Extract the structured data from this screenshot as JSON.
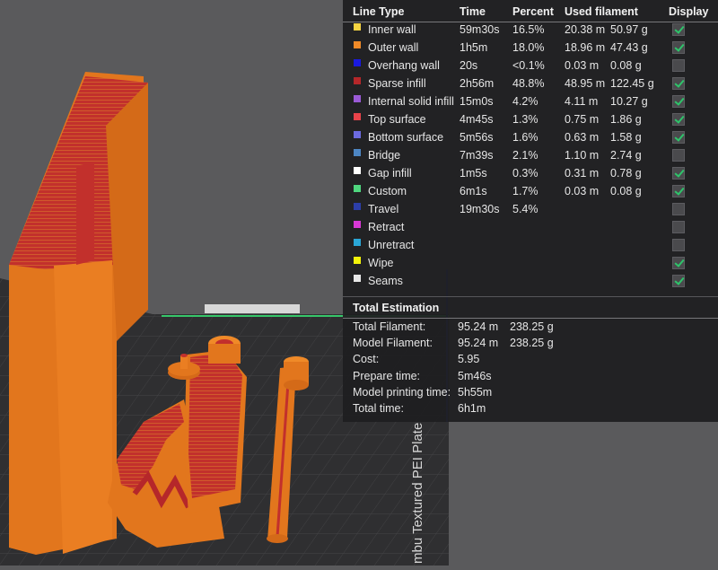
{
  "panel": {
    "headers": {
      "line_type": "Line Type",
      "time": "Time",
      "percent": "Percent",
      "used_filament": "Used filament",
      "display": "Display"
    },
    "rows": [
      {
        "label": "Inner wall",
        "color": "#f5d442",
        "time": "59m30s",
        "percent": "16.5%",
        "length": "20.38 m",
        "weight": "50.97 g",
        "display": true
      },
      {
        "label": "Outer wall",
        "color": "#f08a28",
        "time": "1h5m",
        "percent": "18.0%",
        "length": "18.96 m",
        "weight": "47.43 g",
        "display": true
      },
      {
        "label": "Overhang wall",
        "color": "#1a1adf",
        "time": "20s",
        "percent": "<0.1%",
        "length": "0.03 m",
        "weight": "0.08 g",
        "display": false
      },
      {
        "label": "Sparse infill",
        "color": "#b5272a",
        "time": "2h56m",
        "percent": "48.8%",
        "length": "48.95 m",
        "weight": "122.45 g",
        "display": true
      },
      {
        "label": "Internal solid infill",
        "color": "#9a5ad6",
        "time": "15m0s",
        "percent": "4.2%",
        "length": "4.11 m",
        "weight": "10.27 g",
        "display": true
      },
      {
        "label": "Top surface",
        "color": "#e8434a",
        "time": "4m45s",
        "percent": "1.3%",
        "length": "0.75 m",
        "weight": "1.86 g",
        "display": true
      },
      {
        "label": "Bottom surface",
        "color": "#6c6ae0",
        "time": "5m56s",
        "percent": "1.6%",
        "length": "0.63 m",
        "weight": "1.58 g",
        "display": true
      },
      {
        "label": "Bridge",
        "color": "#4d86c4",
        "time": "7m39s",
        "percent": "2.1%",
        "length": "1.10 m",
        "weight": "2.74 g",
        "display": false
      },
      {
        "label": "Gap infill",
        "color": "#ffffff",
        "time": "1m5s",
        "percent": "0.3%",
        "length": "0.31 m",
        "weight": "0.78 g",
        "display": true
      },
      {
        "label": "Custom",
        "color": "#4fd67e",
        "time": "6m1s",
        "percent": "1.7%",
        "length": "0.03 m",
        "weight": "0.08 g",
        "display": true
      },
      {
        "label": "Travel",
        "color": "#2c3ea8",
        "time": "19m30s",
        "percent": "5.4%",
        "length": "",
        "weight": "",
        "display": false
      },
      {
        "label": "Retract",
        "color": "#d838d6",
        "time": "",
        "percent": "",
        "length": "",
        "weight": "",
        "display": false
      },
      {
        "label": "Unretract",
        "color": "#2aa6d6",
        "time": "",
        "percent": "",
        "length": "",
        "weight": "",
        "display": false
      },
      {
        "label": "Wipe",
        "color": "#f2f20a",
        "time": "",
        "percent": "",
        "length": "",
        "weight": "",
        "display": true
      },
      {
        "label": "Seams",
        "color": "#e8e8e8",
        "time": "",
        "percent": "",
        "length": "",
        "weight": "",
        "display": true
      }
    ],
    "total_title": "Total Estimation",
    "totals": [
      {
        "label": "Total Filament:",
        "v1": "95.24 m",
        "v2": "238.25 g"
      },
      {
        "label": "Model Filament:",
        "v1": "95.24 m",
        "v2": "238.25 g"
      },
      {
        "label": "Cost:",
        "v1": "5.95",
        "v2": ""
      },
      {
        "label": "Prepare time:",
        "v1": "5m46s",
        "v2": ""
      },
      {
        "label": "Model printing time:",
        "v1": "5h55m",
        "v2": ""
      },
      {
        "label": "Total time:",
        "v1": "6h1m",
        "v2": ""
      }
    ]
  },
  "viewport": {
    "plate_label": "mbu Textured PEI Plate"
  },
  "colors": {
    "model_orange": "#e2761d",
    "infill_red": "#c2302c",
    "bed_dark": "#2f2f31",
    "check_green": "#2ec46a"
  }
}
